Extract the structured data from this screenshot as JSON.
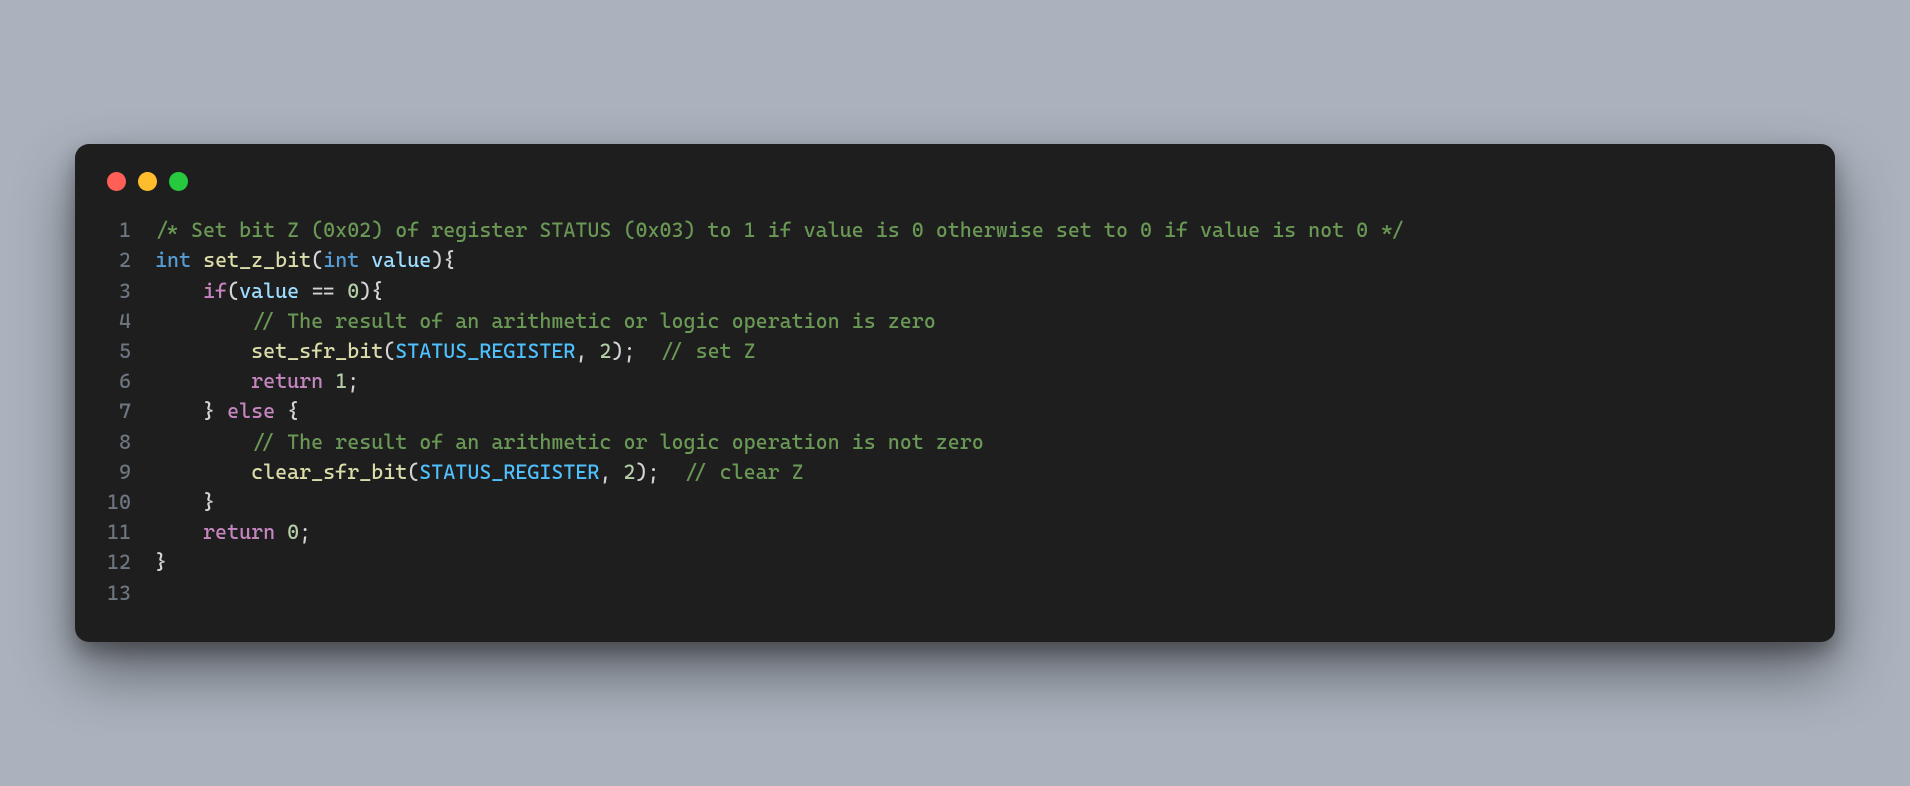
{
  "window": {
    "traffic_light_colors": {
      "red": "#ff5f56",
      "yellow": "#ffbd2e",
      "green": "#27c93f"
    }
  },
  "code": {
    "language": "c",
    "line_numbers": [
      "1",
      "2",
      "3",
      "4",
      "5",
      "6",
      "7",
      "8",
      "9",
      "10",
      "11",
      "12",
      "13"
    ],
    "lines": [
      [
        {
          "t": "/* Set bit Z (0x02) of register STATUS (0x03) to 1 if value is 0 otherwise set to 0 if value is not 0 */",
          "c": "comment"
        }
      ],
      [
        {
          "t": "int",
          "c": "type"
        },
        {
          "t": " ",
          "c": "punct"
        },
        {
          "t": "set_z_bit",
          "c": "func"
        },
        {
          "t": "(",
          "c": "punct"
        },
        {
          "t": "int",
          "c": "type"
        },
        {
          "t": " ",
          "c": "punct"
        },
        {
          "t": "value",
          "c": "var"
        },
        {
          "t": "){",
          "c": "punct"
        }
      ],
      [
        {
          "t": "    ",
          "c": "punct"
        },
        {
          "t": "if",
          "c": "keyword"
        },
        {
          "t": "(",
          "c": "punct"
        },
        {
          "t": "value",
          "c": "var"
        },
        {
          "t": " == ",
          "c": "punct"
        },
        {
          "t": "0",
          "c": "number"
        },
        {
          "t": "){",
          "c": "punct"
        }
      ],
      [
        {
          "t": "        ",
          "c": "punct"
        },
        {
          "t": "// The result of an arithmetic or logic operation is zero",
          "c": "comment"
        }
      ],
      [
        {
          "t": "        ",
          "c": "punct"
        },
        {
          "t": "set_sfr_bit",
          "c": "func"
        },
        {
          "t": "(",
          "c": "punct"
        },
        {
          "t": "STATUS_REGISTER",
          "c": "const"
        },
        {
          "t": ", ",
          "c": "punct"
        },
        {
          "t": "2",
          "c": "number"
        },
        {
          "t": ");  ",
          "c": "punct"
        },
        {
          "t": "// set Z",
          "c": "comment"
        }
      ],
      [
        {
          "t": "        ",
          "c": "punct"
        },
        {
          "t": "return",
          "c": "keyword"
        },
        {
          "t": " ",
          "c": "punct"
        },
        {
          "t": "1",
          "c": "number"
        },
        {
          "t": ";",
          "c": "punct"
        }
      ],
      [
        {
          "t": "    } ",
          "c": "punct"
        },
        {
          "t": "else",
          "c": "keyword"
        },
        {
          "t": " {",
          "c": "punct"
        }
      ],
      [
        {
          "t": "        ",
          "c": "punct"
        },
        {
          "t": "// The result of an arithmetic or logic operation is not zero",
          "c": "comment"
        }
      ],
      [
        {
          "t": "        ",
          "c": "punct"
        },
        {
          "t": "clear_sfr_bit",
          "c": "func"
        },
        {
          "t": "(",
          "c": "punct"
        },
        {
          "t": "STATUS_REGISTER",
          "c": "const"
        },
        {
          "t": ", ",
          "c": "punct"
        },
        {
          "t": "2",
          "c": "number"
        },
        {
          "t": ");  ",
          "c": "punct"
        },
        {
          "t": "// clear Z",
          "c": "comment"
        }
      ],
      [
        {
          "t": "    }",
          "c": "punct"
        }
      ],
      [
        {
          "t": "    ",
          "c": "punct"
        },
        {
          "t": "return",
          "c": "keyword"
        },
        {
          "t": " ",
          "c": "punct"
        },
        {
          "t": "0",
          "c": "number"
        },
        {
          "t": ";",
          "c": "punct"
        }
      ],
      [
        {
          "t": "}",
          "c": "punct"
        }
      ],
      [
        {
          "t": "",
          "c": "punct"
        }
      ]
    ]
  }
}
